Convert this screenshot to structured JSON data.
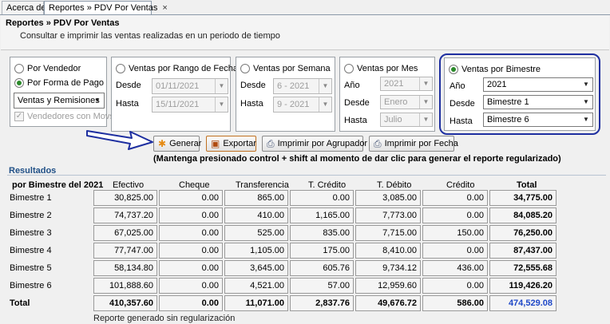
{
  "tabs": [
    {
      "label": "Acerca de"
    },
    {
      "label": "Reportes » PDV Por Ventas",
      "close": "×"
    }
  ],
  "header": {
    "title": "Reportes » PDV Por Ventas",
    "subtitle": "Consultar e imprimir las ventas realizadas en un periodo de tiempo"
  },
  "filters": {
    "vendedor": {
      "por_vendedor": "Por Vendedor",
      "por_forma_pago": "Por Forma de Pago",
      "select_value": "Ventas y Remisiones",
      "check_label": "Vendedores con Movs"
    },
    "rango": {
      "title": "Ventas por Rango de Fechas",
      "desde_label": "Desde",
      "desde_value": "01/11/2021",
      "hasta_label": "Hasta",
      "hasta_value": "15/11/2021"
    },
    "semana": {
      "title": "Ventas por Semana",
      "desde_label": "Desde",
      "desde_value": "6 - 2021",
      "hasta_label": "Hasta",
      "hasta_value": "9 - 2021"
    },
    "mes": {
      "title": "Ventas por Mes",
      "anio_label": "Año",
      "anio_value": "2021",
      "desde_label": "Desde",
      "desde_value": "Enero",
      "hasta_label": "Hasta",
      "hasta_value": "Julio"
    },
    "bimestre": {
      "title": "Ventas por Bimestre",
      "anio_label": "Año",
      "anio_value": "2021",
      "desde_label": "Desde",
      "desde_value": "Bimestre 1",
      "hasta_label": "Hasta",
      "hasta_value": "Bimestre 6"
    }
  },
  "actions": {
    "generar": "Generar",
    "exportar": "Exportar",
    "imprimir_agrupador": "Imprimir por Agrupador",
    "imprimir_fecha": "Imprimir por Fecha",
    "note": "(Mantenga presionado control + shift al momento de dar clic para generar el reporte regularizado)"
  },
  "results": {
    "title": "Resultados",
    "group_header": "por Bimestre del 2021",
    "columns": [
      "Efectivo",
      "Cheque",
      "Transferencia",
      "T. Crédito",
      "T. Débito",
      "Crédito",
      "Total"
    ],
    "rows": [
      {
        "label": "Bimestre 1",
        "values": [
          "30,825.00",
          "0.00",
          "865.00",
          "0.00",
          "3,085.00",
          "0.00",
          "34,775.00"
        ]
      },
      {
        "label": "Bimestre 2",
        "values": [
          "74,737.20",
          "0.00",
          "410.00",
          "1,165.00",
          "7,773.00",
          "0.00",
          "84,085.20"
        ]
      },
      {
        "label": "Bimestre 3",
        "values": [
          "67,025.00",
          "0.00",
          "525.00",
          "835.00",
          "7,715.00",
          "150.00",
          "76,250.00"
        ]
      },
      {
        "label": "Bimestre 4",
        "values": [
          "77,747.00",
          "0.00",
          "1,105.00",
          "175.00",
          "8,410.00",
          "0.00",
          "87,437.00"
        ]
      },
      {
        "label": "Bimestre 5",
        "values": [
          "58,134.80",
          "0.00",
          "3,645.00",
          "605.76",
          "9,734.12",
          "436.00",
          "72,555.68"
        ]
      },
      {
        "label": "Bimestre 6",
        "values": [
          "101,888.60",
          "0.00",
          "4,521.00",
          "57.00",
          "12,959.60",
          "0.00",
          "119,426.20"
        ]
      }
    ],
    "total": {
      "label": "Total",
      "values": [
        "410,357.60",
        "0.00",
        "11,071.00",
        "2,837.76",
        "49,676.72",
        "586.00",
        "474,529.08"
      ]
    },
    "footer": "Reporte generado sin regularización"
  }
}
